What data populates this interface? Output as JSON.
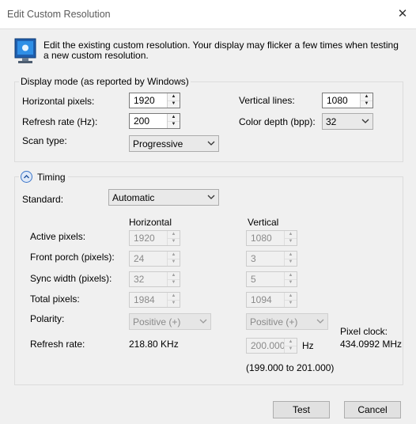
{
  "window": {
    "title": "Edit Custom Resolution"
  },
  "intro_text": "Edit the existing custom resolution. Your display may flicker a few times when testing a new custom resolution.",
  "display_mode": {
    "group_title": "Display mode (as reported by Windows)",
    "horizontal_pixels_label": "Horizontal pixels:",
    "horizontal_pixels": "1920",
    "vertical_lines_label": "Vertical lines:",
    "vertical_lines": "1080",
    "refresh_rate_label": "Refresh rate (Hz):",
    "refresh_rate": "200",
    "color_depth_label": "Color depth (bpp):",
    "color_depth": "32",
    "scan_type_label": "Scan type:",
    "scan_type": "Progressive"
  },
  "timing": {
    "section_title": "Timing",
    "standard_label": "Standard:",
    "standard": "Automatic",
    "horizontal_header": "Horizontal",
    "vertical_header": "Vertical",
    "rows": {
      "active": {
        "label": "Active pixels:",
        "h": "1920",
        "v": "1080"
      },
      "front_porch": {
        "label": "Front porch (pixels):",
        "h": "24",
        "v": "3"
      },
      "sync_width": {
        "label": "Sync width (pixels):",
        "h": "32",
        "v": "5"
      },
      "total": {
        "label": "Total pixels:",
        "h": "1984",
        "v": "1094"
      }
    },
    "polarity_label": "Polarity:",
    "polarity_h": "Positive (+)",
    "polarity_v": "Positive (+)",
    "pixel_clock_label": "Pixel clock:",
    "pixel_clock": "434.0992 MHz",
    "refresh_rate_label": "Refresh rate:",
    "h_refresh": "218.80 KHz",
    "v_refresh": "200.000",
    "v_refresh_unit": "Hz",
    "range": "(199.000 to 201.000)"
  },
  "buttons": {
    "test": "Test",
    "cancel": "Cancel"
  },
  "icons": {
    "close": "close-icon",
    "monitor": "monitor-icon",
    "expander": "collapse-chevron-icon"
  }
}
